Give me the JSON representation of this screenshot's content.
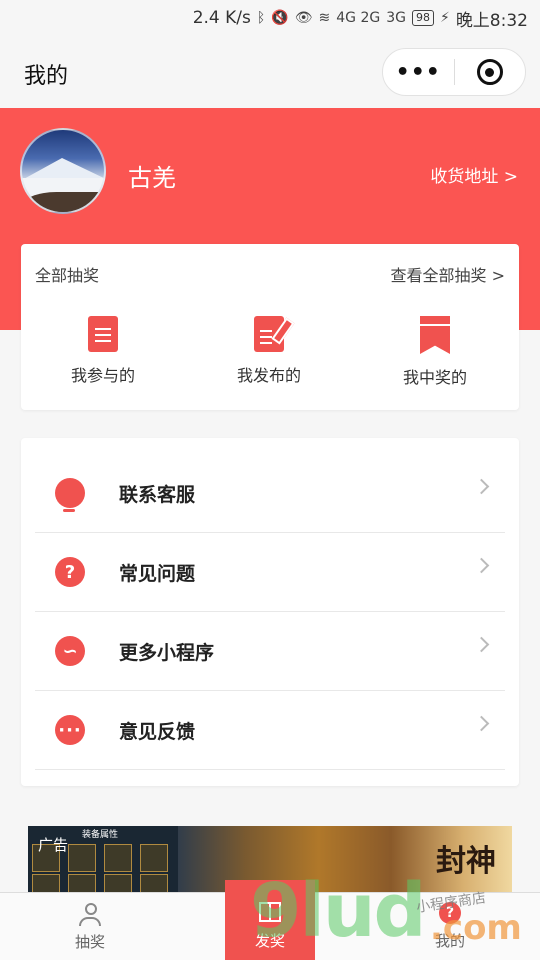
{
  "status_bar": {
    "speed": "2.4 K/s",
    "network": "4G 2G",
    "network_3g": "3G",
    "battery": "98",
    "time": "晚上8:32"
  },
  "nav": {
    "title": "我的",
    "more_icon": "•••"
  },
  "profile": {
    "name": "古羌",
    "address_link": "收货地址 >"
  },
  "lottery": {
    "title": "全部抽奖",
    "view_all": "查看全部抽奖 >",
    "items": [
      {
        "label": "我参与的",
        "icon": "document-icon"
      },
      {
        "label": "我发布的",
        "icon": "edit-document-icon"
      },
      {
        "label": "我中奖的",
        "icon": "bookmark-icon"
      }
    ]
  },
  "menu": {
    "items": [
      {
        "label": "联系客服",
        "icon": "headset-icon"
      },
      {
        "label": "常见问题",
        "icon": "question-icon",
        "glyph": "?"
      },
      {
        "label": "更多小程序",
        "icon": "link-icon",
        "glyph": "∽"
      },
      {
        "label": "意见反馈",
        "icon": "chat-icon",
        "glyph": "···"
      }
    ]
  },
  "ad": {
    "tag": "广告",
    "subtitle": "装备属性",
    "title": "封神"
  },
  "tabs": [
    {
      "label": "抽奖",
      "icon": "person-icon"
    },
    {
      "label": "发奖",
      "icon": "gift-icon"
    },
    {
      "label": "我的",
      "icon": "question-badge-icon",
      "glyph": "?"
    }
  ],
  "watermark": {
    "brand": "9lud",
    "domain": ".com",
    "store": "小程序商店"
  },
  "colors": {
    "accent": "#fb5552",
    "icon_red": "#f0524f"
  }
}
